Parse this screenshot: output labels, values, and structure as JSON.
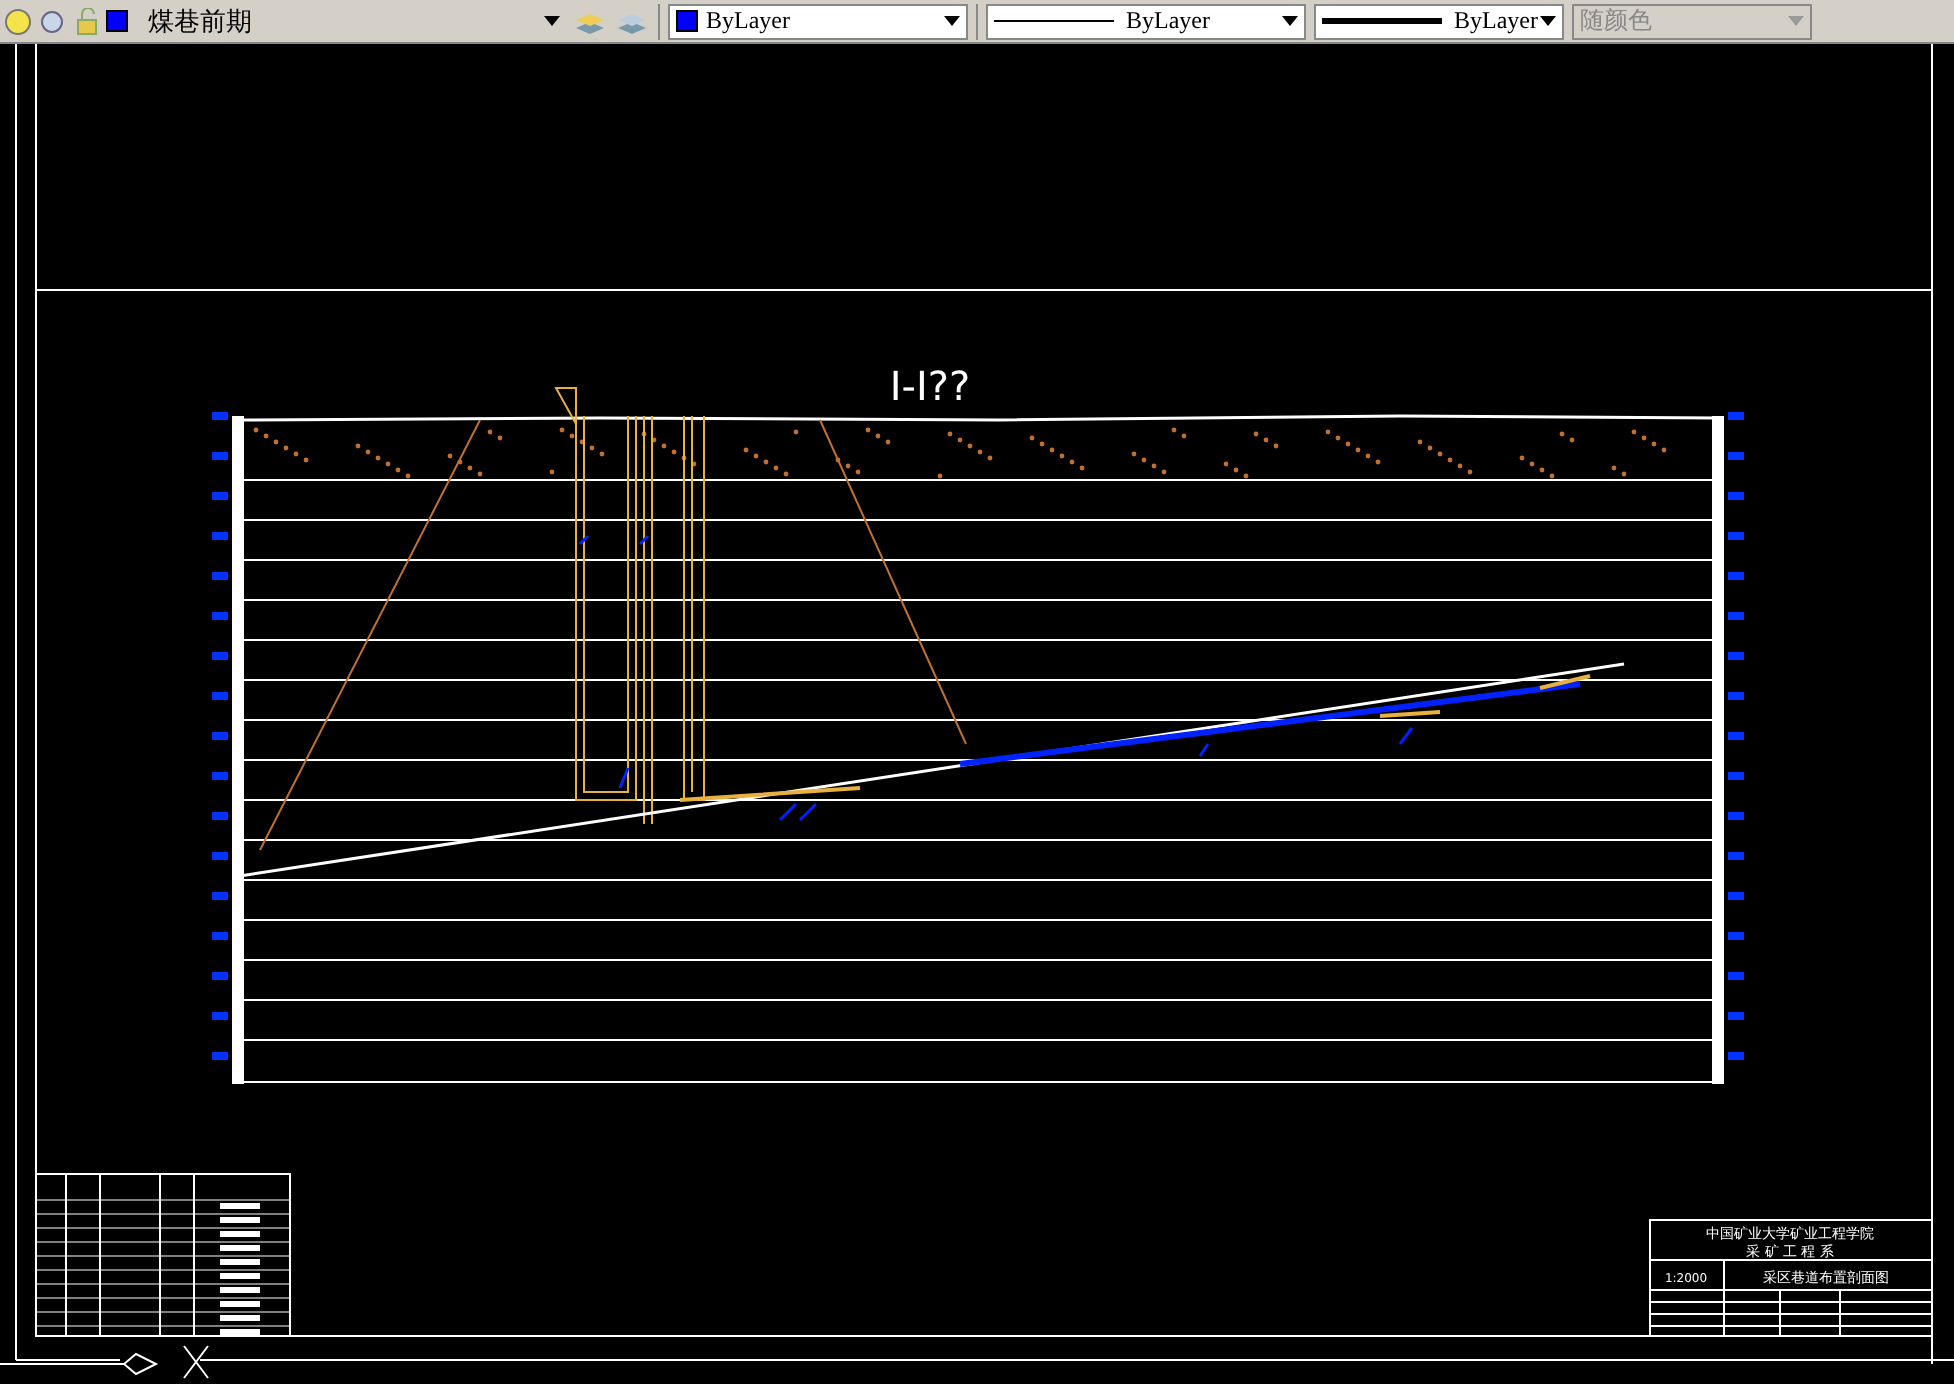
{
  "toolbar": {
    "layer": {
      "name": "煤巷前期"
    },
    "color": {
      "label": "ByLayer"
    },
    "linetype": {
      "label": "ByLayer"
    },
    "lineweight": {
      "label": "ByLayer"
    },
    "plot_style": {
      "label": "随颜色",
      "disabled": true
    }
  },
  "drawing": {
    "title": "I-I??",
    "title_block": {
      "school": "中国矿业大学矿业工程学院",
      "department": "采 矿 工 程 系",
      "scale": "1:2000",
      "drawing_name": "采区巷道布置剖面图"
    }
  }
}
